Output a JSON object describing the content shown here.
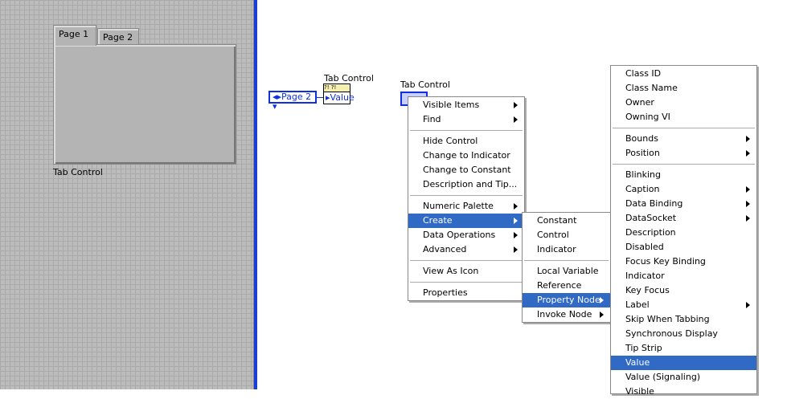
{
  "front_panel": {
    "tabs": [
      "Page 1",
      "Page 2"
    ],
    "control_label": "Tab Control"
  },
  "block_diagram": {
    "terminal_label": "Tab Control",
    "terminal_value": "Value",
    "terminal_glyph": "?! ?!",
    "ring_value": "Page 2",
    "control2_label": "Tab Control"
  },
  "menu_main": [
    {
      "label": "Visible Items",
      "sub": true
    },
    {
      "label": "Find",
      "sub": true
    },
    {
      "sep": true
    },
    {
      "label": "Hide Control"
    },
    {
      "label": "Change to Indicator"
    },
    {
      "label": "Change to Constant"
    },
    {
      "label": "Description and Tip..."
    },
    {
      "sep": true
    },
    {
      "label": "Numeric Palette",
      "sub": true
    },
    {
      "label": "Create",
      "sub": true,
      "hl": true
    },
    {
      "label": "Data Operations",
      "sub": true
    },
    {
      "label": "Advanced",
      "sub": true
    },
    {
      "sep": true
    },
    {
      "label": "View As Icon"
    },
    {
      "sep": true
    },
    {
      "label": "Properties"
    }
  ],
  "menu_create": [
    {
      "label": "Constant"
    },
    {
      "label": "Control"
    },
    {
      "label": "Indicator"
    },
    {
      "sep": true
    },
    {
      "label": "Local Variable"
    },
    {
      "label": "Reference"
    },
    {
      "label": "Property Node",
      "sub": true,
      "hl": true
    },
    {
      "label": "Invoke Node",
      "sub": true
    }
  ],
  "menu_property": [
    {
      "label": "Class ID"
    },
    {
      "label": "Class Name"
    },
    {
      "label": "Owner"
    },
    {
      "label": "Owning VI"
    },
    {
      "sep": true
    },
    {
      "label": "Bounds",
      "sub": true
    },
    {
      "label": "Position",
      "sub": true
    },
    {
      "sep": true
    },
    {
      "label": "Blinking"
    },
    {
      "label": "Caption",
      "sub": true
    },
    {
      "label": "Data Binding",
      "sub": true
    },
    {
      "label": "DataSocket",
      "sub": true
    },
    {
      "label": "Description"
    },
    {
      "label": "Disabled"
    },
    {
      "label": "Focus Key Binding"
    },
    {
      "label": "Indicator"
    },
    {
      "label": "Key Focus"
    },
    {
      "label": "Label",
      "sub": true
    },
    {
      "label": "Skip When Tabbing"
    },
    {
      "label": "Synchronous Display"
    },
    {
      "label": "Tip Strip"
    },
    {
      "label": "Value",
      "hl": true
    },
    {
      "label": "Value (Signaling)"
    },
    {
      "label": "Visible"
    }
  ]
}
